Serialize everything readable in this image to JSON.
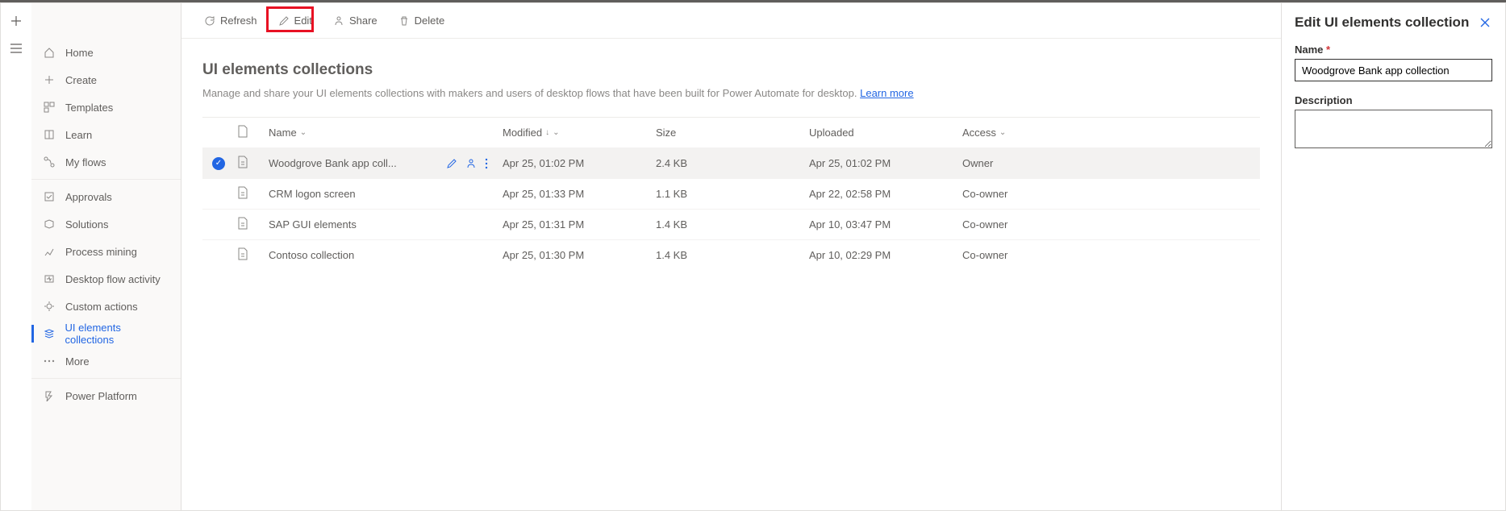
{
  "toolbar": {
    "refresh": "Refresh",
    "edit": "Edit",
    "share": "Share",
    "delete": "Delete"
  },
  "sidebar": {
    "group1": [
      {
        "label": "Home"
      },
      {
        "label": "Create"
      },
      {
        "label": "Templates"
      },
      {
        "label": "Learn"
      },
      {
        "label": "My flows"
      }
    ],
    "group2": [
      {
        "label": "Approvals"
      },
      {
        "label": "Solutions"
      },
      {
        "label": "Process mining"
      },
      {
        "label": "Desktop flow activity"
      },
      {
        "label": "Custom actions"
      },
      {
        "label": "UI elements collections"
      },
      {
        "label": "More"
      }
    ],
    "group3": [
      {
        "label": "Power Platform"
      }
    ]
  },
  "page": {
    "title": "UI elements collections",
    "description": "Manage and share your UI elements collections with makers and users of desktop flows that have been built for Power Automate for desktop. ",
    "learn_more": "Learn more"
  },
  "columns": {
    "name": "Name",
    "modified": "Modified",
    "size": "Size",
    "uploaded": "Uploaded",
    "access": "Access"
  },
  "rows": [
    {
      "name": "Woodgrove Bank app coll...",
      "modified": "Apr 25, 01:02 PM",
      "size": "2.4 KB",
      "uploaded": "Apr 25, 01:02 PM",
      "access": "Owner",
      "selected": true
    },
    {
      "name": "CRM logon screen",
      "modified": "Apr 25, 01:33 PM",
      "size": "1.1 KB",
      "uploaded": "Apr 22, 02:58 PM",
      "access": "Co-owner",
      "selected": false
    },
    {
      "name": "SAP GUI elements",
      "modified": "Apr 25, 01:31 PM",
      "size": "1.4 KB",
      "uploaded": "Apr 10, 03:47 PM",
      "access": "Co-owner",
      "selected": false
    },
    {
      "name": "Contoso collection",
      "modified": "Apr 25, 01:30 PM",
      "size": "1.4 KB",
      "uploaded": "Apr 10, 02:29 PM",
      "access": "Co-owner",
      "selected": false
    }
  ],
  "panel": {
    "title": "Edit UI elements collection",
    "name_label": "Name",
    "name_value": "Woodgrove Bank app collection",
    "desc_label": "Description",
    "desc_value": ""
  }
}
